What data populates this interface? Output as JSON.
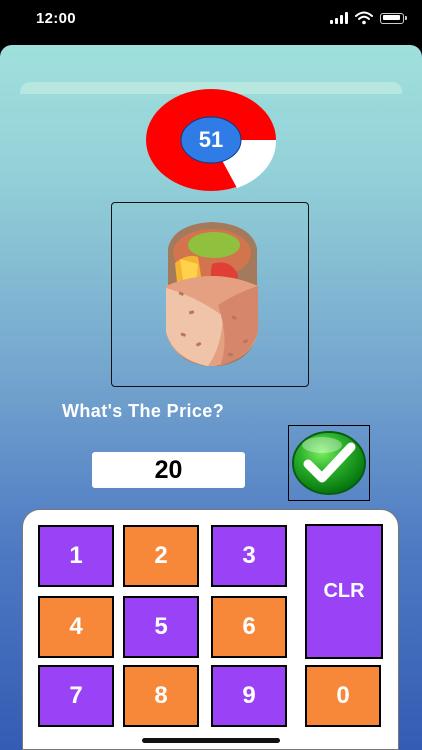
{
  "status_bar": {
    "time": "12:00"
  },
  "game": {
    "timer_value": "51",
    "question": "What's The Price?",
    "answer_value": "20",
    "item_image": "burrito-wrap",
    "submit_icon": "green-checkmark-icon"
  },
  "keypad": {
    "keys": [
      "1",
      "2",
      "3",
      "CLR",
      "4",
      "5",
      "6",
      "7",
      "8",
      "9",
      "0"
    ]
  },
  "colors": {
    "timer_red": "#ff0000",
    "timer_blue": "#2f7ce6",
    "purple_key": "#9a42f5",
    "orange_key": "#f7883a",
    "submit_green": "#2db22c",
    "background_top": "#9fe0dc",
    "background_bottom": "#345cb4"
  }
}
